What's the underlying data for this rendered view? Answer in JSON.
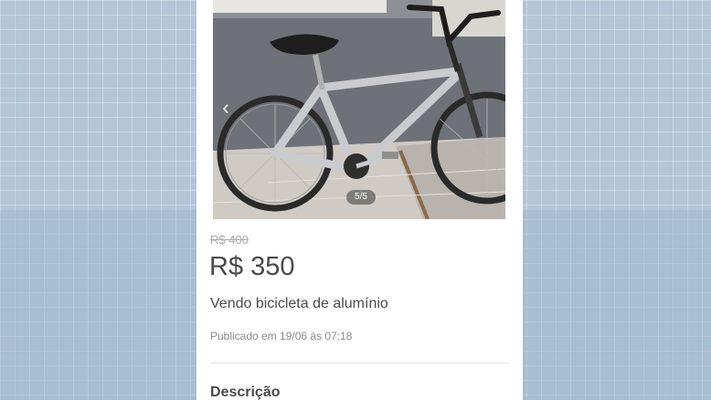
{
  "listing": {
    "old_price": "R$ 400",
    "price": "R$ 350",
    "title": "Vendo bicicleta de alumínio",
    "published": "Publicado em 19/06 às 07:18",
    "description_heading": "Descrição"
  },
  "gallery": {
    "counter": "5/5",
    "prev_icon": "chevron-left-icon",
    "prev_glyph": "‹"
  },
  "colors": {
    "background": "#b3c6d8",
    "card": "#ffffff",
    "text": "#4a4a4a",
    "muted": "#8a8a8a"
  }
}
